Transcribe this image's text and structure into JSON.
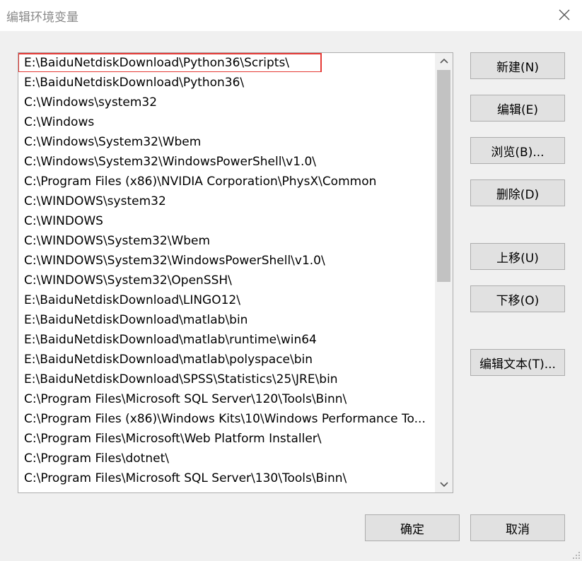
{
  "window": {
    "title": "编辑环境变量"
  },
  "list": {
    "items": [
      "E:\\BaiduNetdiskDownload\\Python36\\Scripts\\",
      "E:\\BaiduNetdiskDownload\\Python36\\",
      "C:\\Windows\\system32",
      "C:\\Windows",
      "C:\\Windows\\System32\\Wbem",
      "C:\\Windows\\System32\\WindowsPowerShell\\v1.0\\",
      "C:\\Program Files (x86)\\NVIDIA Corporation\\PhysX\\Common",
      "C:\\WINDOWS\\system32",
      "C:\\WINDOWS",
      "C:\\WINDOWS\\System32\\Wbem",
      "C:\\WINDOWS\\System32\\WindowsPowerShell\\v1.0\\",
      "C:\\WINDOWS\\System32\\OpenSSH\\",
      "E:\\BaiduNetdiskDownload\\LINGO12\\",
      "E:\\BaiduNetdiskDownload\\matlab\\bin",
      "E:\\BaiduNetdiskDownload\\matlab\\runtime\\win64",
      "E:\\BaiduNetdiskDownload\\matlab\\polyspace\\bin",
      "E:\\BaiduNetdiskDownload\\SPSS\\Statistics\\25\\JRE\\bin",
      "C:\\Program Files\\Microsoft SQL Server\\120\\Tools\\Binn\\",
      "C:\\Program Files (x86)\\Windows Kits\\10\\Windows Performance To...",
      "C:\\Program Files\\Microsoft\\Web Platform Installer\\",
      "C:\\Program Files\\dotnet\\",
      "C:\\Program Files\\Microsoft SQL Server\\130\\Tools\\Binn\\"
    ],
    "highlighted_color": "#e53935"
  },
  "buttons": {
    "new": "新建(N)",
    "edit": "编辑(E)",
    "browse": "浏览(B)...",
    "delete": "删除(D)",
    "move_up": "上移(U)",
    "move_down": "下移(O)",
    "edit_text": "编辑文本(T)...",
    "ok": "确定",
    "cancel": "取消"
  },
  "icons": {
    "close": "close-icon",
    "scroll_up": "chevron-up-icon",
    "scroll_down": "chevron-down-icon",
    "resize": "resize-grip-icon"
  }
}
